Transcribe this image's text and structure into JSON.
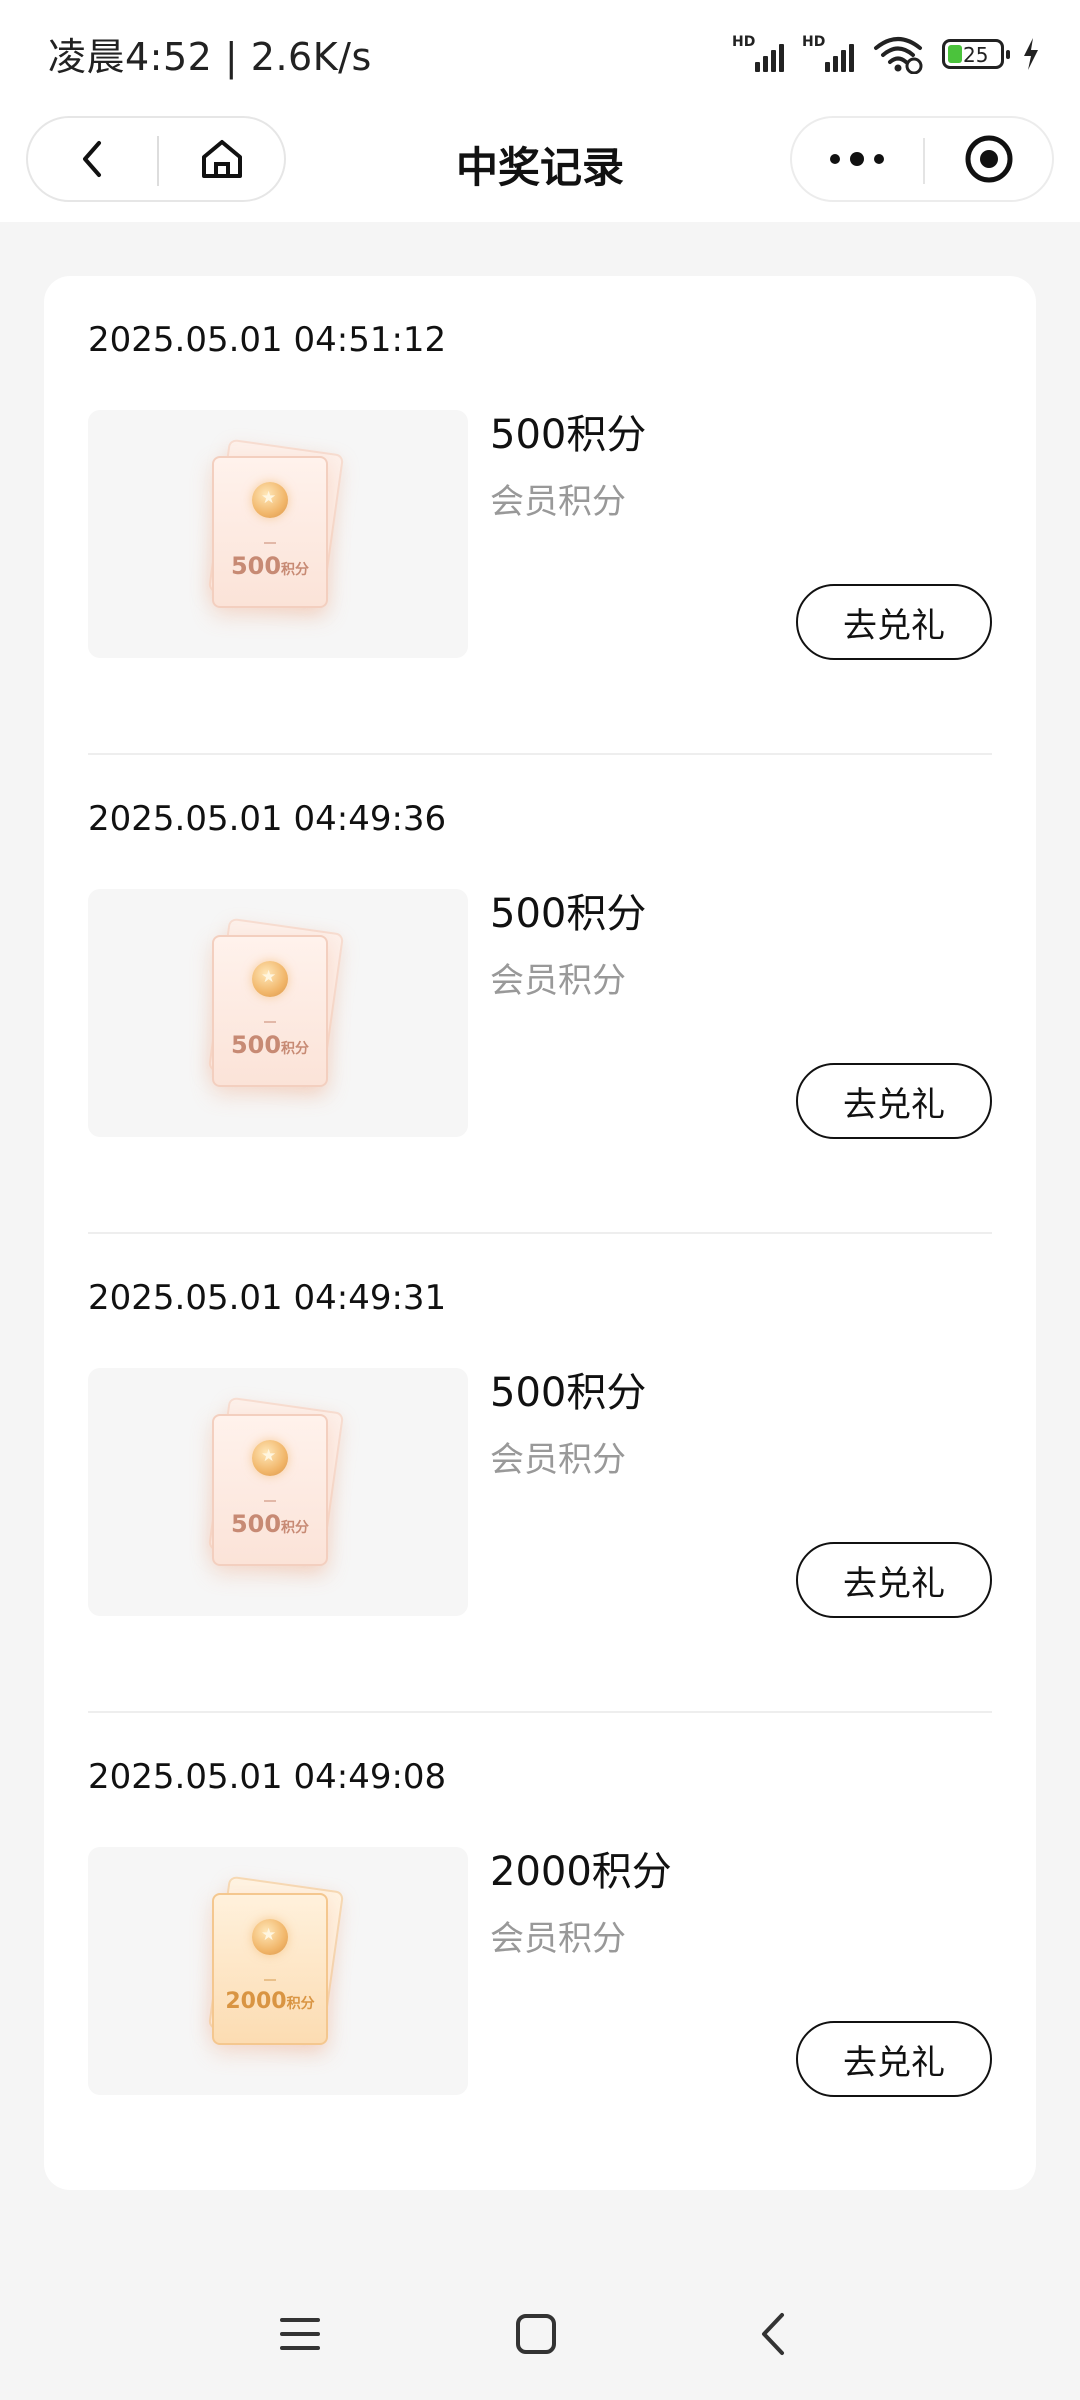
{
  "status_bar": {
    "time_speed": "凌晨4:52 | 2.6K/s",
    "sim1_label": "HD",
    "sim2_label": "HD",
    "battery_level": "25"
  },
  "nav": {
    "title": "中奖记录",
    "back_icon": "chevron-left-icon",
    "home_icon": "home-icon",
    "more_icon": "more-dots-icon",
    "target_icon": "target-icon"
  },
  "records": [
    {
      "time": "2025.05.01 04:51:12",
      "prize": "500积分",
      "type": "会员积分",
      "button": "去兑礼",
      "thumb_value": "500",
      "thumb_unit": "积分"
    },
    {
      "time": "2025.05.01 04:49:36",
      "prize": "500积分",
      "type": "会员积分",
      "button": "去兑礼",
      "thumb_value": "500",
      "thumb_unit": "积分"
    },
    {
      "time": "2025.05.01 04:49:31",
      "prize": "500积分",
      "type": "会员积分",
      "button": "去兑礼",
      "thumb_value": "500",
      "thumb_unit": "积分"
    },
    {
      "time": "2025.05.01 04:49:08",
      "prize": "2000积分",
      "type": "会员积分",
      "button": "去兑礼",
      "thumb_value": "2000",
      "thumb_unit": "积分"
    }
  ],
  "system_nav": {
    "menu_icon": "menu-icon",
    "home_icon": "square-home-icon",
    "back_icon": "back-chevron-icon"
  },
  "colors": {
    "background": "#f5f5f5",
    "card": "#ffffff",
    "secondary_text": "#999999",
    "battery_green": "#4bc33c"
  }
}
